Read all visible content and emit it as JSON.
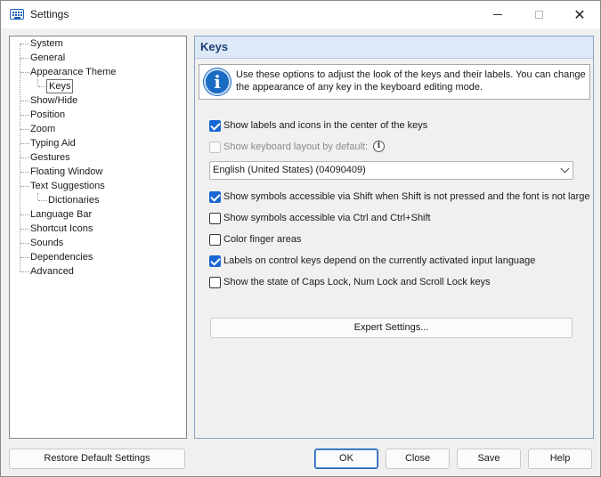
{
  "window": {
    "title": "Settings"
  },
  "tree": {
    "items": [
      {
        "label": "System"
      },
      {
        "label": "General"
      },
      {
        "label": "Appearance Theme"
      },
      {
        "label": "Keys"
      },
      {
        "label": "Show/Hide"
      },
      {
        "label": "Position"
      },
      {
        "label": "Zoom"
      },
      {
        "label": "Typing Aid"
      },
      {
        "label": "Gestures"
      },
      {
        "label": "Floating Window"
      },
      {
        "label": "Text Suggestions"
      },
      {
        "label": "Dictionaries"
      },
      {
        "label": "Language Bar"
      },
      {
        "label": "Shortcut Icons"
      },
      {
        "label": "Sounds"
      },
      {
        "label": "Dependencies"
      },
      {
        "label": "Advanced"
      }
    ],
    "selected": "Keys"
  },
  "panel": {
    "title": "Keys",
    "info_text": "Use these options to adjust the look of the keys and their labels. You can change the appearance of any key in the keyboard editing mode.",
    "info_icon": "info-icon",
    "options": [
      {
        "label": "Show labels and icons in the center of the keys",
        "checked": true,
        "disabled": false
      },
      {
        "label": "Show keyboard layout by default:",
        "checked": false,
        "disabled": true
      },
      {
        "label": "Show symbols accessible via Shift when Shift is not pressed and the font is not large",
        "checked": true,
        "disabled": false
      },
      {
        "label": "Show symbols accessible via Ctrl and Ctrl+Shift",
        "checked": false,
        "disabled": false
      },
      {
        "label": "Color finger areas",
        "checked": false,
        "disabled": false
      },
      {
        "label": "Labels on control keys depend on the currently activated input language",
        "checked": true,
        "disabled": false
      },
      {
        "label": "Show the state of Caps Lock, Num Lock and Scroll Lock keys",
        "checked": false,
        "disabled": false
      }
    ],
    "layout_select": {
      "value": "English (United States) (04090409)"
    },
    "expert_button": "Expert Settings..."
  },
  "footer": {
    "restore_label": "Restore Default Settings",
    "ok_label": "OK",
    "close_label": "Close",
    "save_label": "Save",
    "help_label": "Help"
  }
}
